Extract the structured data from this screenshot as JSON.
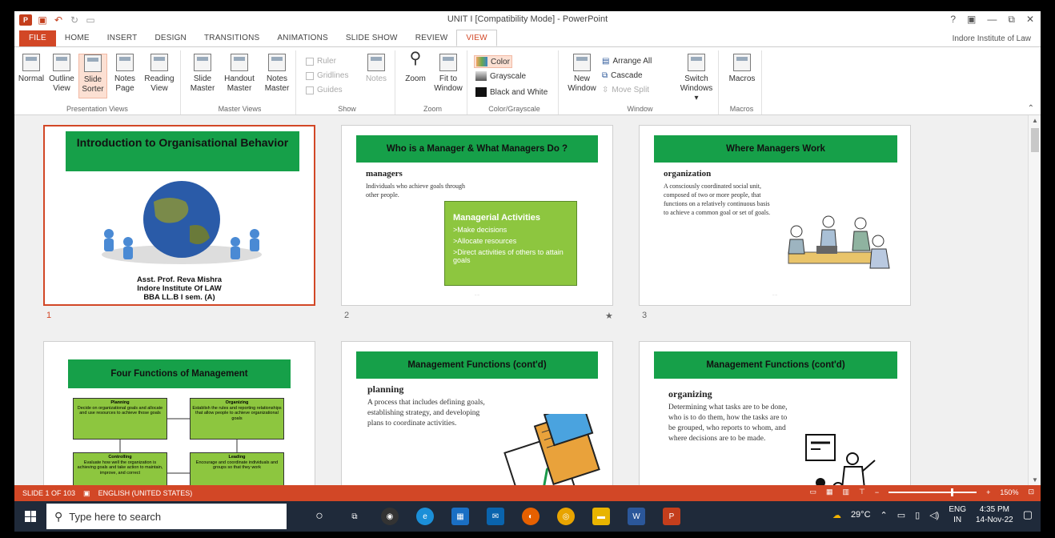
{
  "window": {
    "title": "UNIT I [Compatibility Mode] - PowerPoint",
    "user": "Indore Institute of Law",
    "controls": [
      "?",
      "▣",
      "—",
      "⧉",
      "✕"
    ]
  },
  "tabs": [
    "FILE",
    "HOME",
    "INSERT",
    "DESIGN",
    "TRANSITIONS",
    "ANIMATIONS",
    "SLIDE SHOW",
    "REVIEW",
    "VIEW"
  ],
  "active_tab": "VIEW",
  "ribbon": {
    "presentation_views": {
      "label": "Presentation Views",
      "buttons": [
        {
          "l1": "Normal",
          "l2": ""
        },
        {
          "l1": "Outline",
          "l2": "View"
        },
        {
          "l1": "Slide",
          "l2": "Sorter"
        },
        {
          "l1": "Notes",
          "l2": "Page"
        },
        {
          "l1": "Reading",
          "l2": "View"
        }
      ]
    },
    "master_views": {
      "label": "Master Views",
      "buttons": [
        {
          "l1": "Slide",
          "l2": "Master"
        },
        {
          "l1": "Handout",
          "l2": "Master"
        },
        {
          "l1": "Notes",
          "l2": "Master"
        }
      ]
    },
    "show": {
      "label": "Show",
      "items": [
        "Ruler",
        "Gridlines",
        "Guides"
      ],
      "notes": "Notes"
    },
    "zoom": {
      "label": "Zoom",
      "zoom": "Zoom",
      "fit_l1": "Fit to",
      "fit_l2": "Window"
    },
    "color": {
      "label": "Color/Grayscale",
      "items": [
        "Color",
        "Grayscale",
        "Black and White"
      ]
    },
    "window": {
      "label": "Window",
      "new_l1": "New",
      "new_l2": "Window",
      "items": [
        "Arrange All",
        "Cascade",
        "Move Split"
      ],
      "switch_l1": "Switch",
      "switch_l2": "Windows ▾"
    },
    "macros": {
      "label": "Macros",
      "btn": "Macros"
    }
  },
  "slides": [
    {
      "num": "1",
      "title": "Introduction to Organisational Behavior",
      "lines": [
        "Asst. Prof. Reva Mishra",
        "Indore Institute Of LAW",
        "BBA LL.B I sem. (A)"
      ]
    },
    {
      "num": "2",
      "title": "Who is a Manager & What Managers Do ?",
      "heading": "managers",
      "body": "Individuals who achieve goals through other people.",
      "box_title": "Managerial Activities",
      "box_items": [
        ">Make decisions",
        ">Allocate resources",
        ">Direct activities of others to attain goals"
      ],
      "star": "★"
    },
    {
      "num": "3",
      "title": "Where Managers Work",
      "heading": "organization",
      "body": "A consciously coordinated social unit, composed of two or more people, that functions on a relatively continuous basis to achieve a common goal or set of goals."
    },
    {
      "title": "Four Functions of Management",
      "boxes": [
        {
          "head": "Planning",
          "text": "Decide on organizational goals and allocate and use resources to achieve those goals"
        },
        {
          "head": "Organizing",
          "text": "Establish the rules and reporting relationships that allow people to achieve organizational goals"
        },
        {
          "head": "Controlling",
          "text": "Evaluate how well the organization is achieving goals and take action to maintain, improve, and correct"
        },
        {
          "head": "Leading",
          "text": "Encourage and coordinate individuals and groups so that they work"
        }
      ]
    },
    {
      "title": "Management Functions (cont'd)",
      "heading": "planning",
      "body": "A process that includes defining goals, establishing strategy, and developing plans to coordinate activities."
    },
    {
      "title": "Management Functions (cont'd)",
      "heading": "organizing",
      "body": "Determining what tasks are to be done, who is to do them, how the tasks are to be grouped, who reports to whom, and where decisions are to be made."
    }
  ],
  "status": {
    "slide": "SLIDE 1 OF 103",
    "lang": "ENGLISH (UNITED STATES)",
    "zoom": "150%"
  },
  "taskbar": {
    "search": "Type here to search",
    "weather": "29°C",
    "lang1": "ENG",
    "lang2": "IN",
    "time": "4:35 PM",
    "date": "14-Nov-22"
  },
  "colors": {
    "accent": "#d24726",
    "slide_green": "#16a049",
    "box_green": "#8dc63f",
    "taskbar": "#1f2a3a"
  }
}
